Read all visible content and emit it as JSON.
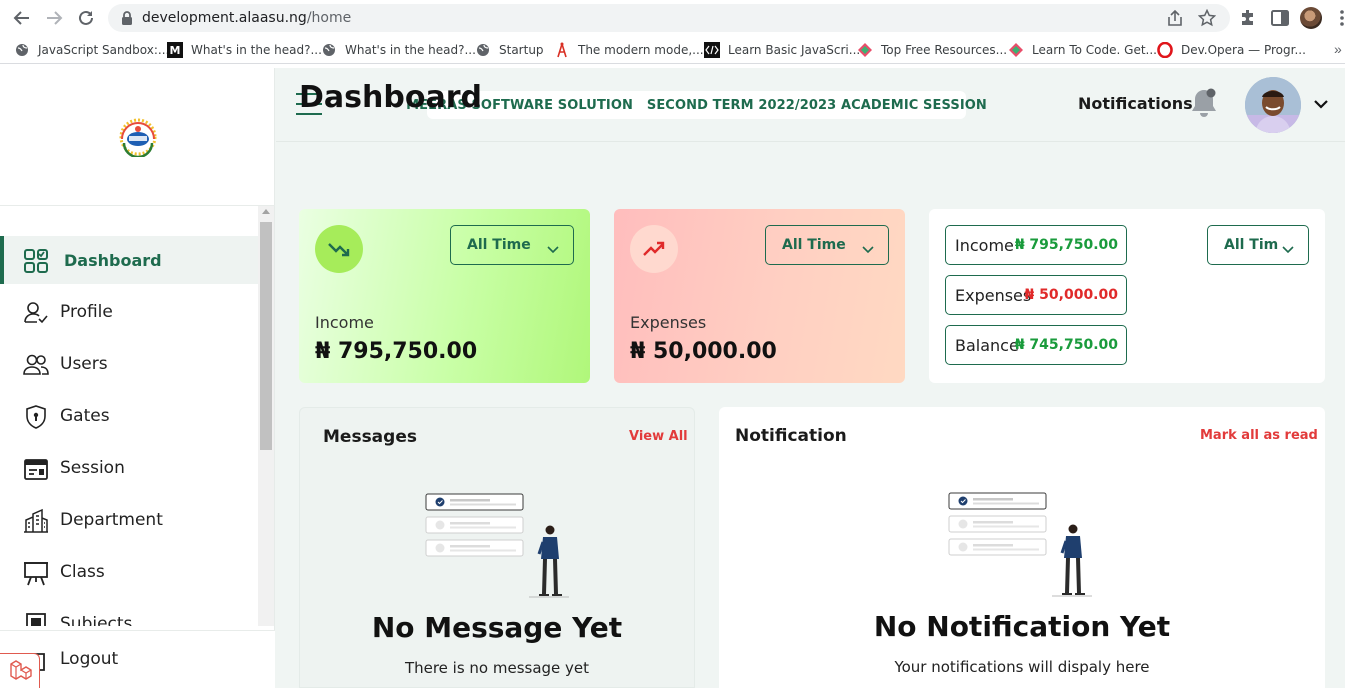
{
  "browser": {
    "url_host": "development.alaasu.ng",
    "url_path": "/home",
    "bookmarks": [
      {
        "label": "JavaScript Sandbox:...",
        "icon": "globe-icon"
      },
      {
        "label": "What's in the head?...",
        "icon": "medium-icon"
      },
      {
        "label": "What's in the head?...",
        "icon": "globe-icon"
      },
      {
        "label": "Startup",
        "icon": "globe-icon"
      },
      {
        "label": "The modern mode,...",
        "icon": "tower-icon"
      },
      {
        "label": "Learn Basic JavaScri...",
        "icon": "codepen-icon"
      },
      {
        "label": "Top Free Resources...",
        "icon": "diamond-icon"
      },
      {
        "label": "Learn To Code. Get...",
        "icon": "diamond-icon"
      },
      {
        "label": "Dev.Opera — Progr...",
        "icon": "opera-icon"
      }
    ],
    "more_bookmarks": "»"
  },
  "sidebar": {
    "items": [
      {
        "label": "Dashboard",
        "icon": "grid-icon",
        "active": true
      },
      {
        "label": "Profile",
        "icon": "user-check-icon"
      },
      {
        "label": "Users",
        "icon": "users-icon"
      },
      {
        "label": "Gates",
        "icon": "shield-lock-icon"
      },
      {
        "label": "Session",
        "icon": "calendar-icon"
      },
      {
        "label": "Department",
        "icon": "building-icon"
      },
      {
        "label": "Class",
        "icon": "easel-icon"
      },
      {
        "label": "Subjects",
        "icon": "book-icon"
      }
    ],
    "logout_label": "Logout"
  },
  "header": {
    "session_text": "MEERAS SOFTWARE SOLUTION   SECOND TERM 2022/2023 ACADEMIC SESSION",
    "notifications_label": "Notifications"
  },
  "main": {
    "title": "Dashboard",
    "income_card": {
      "filter": "All Time",
      "label": "Income",
      "value": "₦ 795,750.00"
    },
    "expense_card": {
      "filter": "All Time",
      "label": "Expenses",
      "value": "₦ 50,000.00"
    },
    "summary_card": {
      "filter": "All Tim",
      "rows": [
        {
          "label": "Income",
          "value": "₦ 795,750.00"
        },
        {
          "label": "Expenses",
          "value": "₦ 50,000.00"
        },
        {
          "label": "Balance",
          "value": "₦ 745,750.00"
        }
      ]
    },
    "messages": {
      "title": "Messages",
      "link": "View All",
      "empty_title": "No Message Yet",
      "empty_sub": "There is no message yet"
    },
    "notification": {
      "title": "Notification",
      "link": "Mark all as read",
      "empty_title": "No Notification Yet",
      "empty_sub": "Your notifications will dispaly here"
    }
  },
  "colors": {
    "brand_green": "#1e6b4e",
    "positive": "#1a9b3c",
    "negative": "#e02a2a",
    "link_red": "#e23b3b"
  }
}
